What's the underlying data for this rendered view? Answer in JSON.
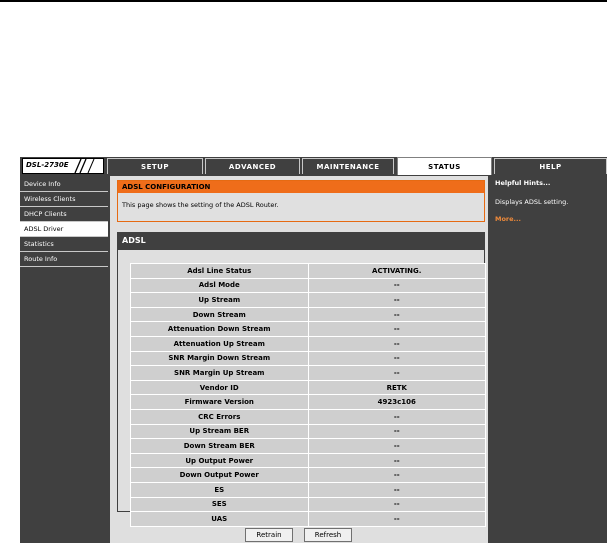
{
  "device": {
    "model": "DSL-2730E"
  },
  "tabs": [
    {
      "label": "SETUP",
      "active": false
    },
    {
      "label": "ADVANCED",
      "active": false
    },
    {
      "label": "MAINTENANCE",
      "active": false
    },
    {
      "label": "STATUS",
      "active": true
    },
    {
      "label": "HELP",
      "active": false
    }
  ],
  "sidebar": {
    "items": [
      {
        "label": "Device Info"
      },
      {
        "label": "Wireless Clients"
      },
      {
        "label": "DHCP Clients"
      },
      {
        "label": "ADSL Driver",
        "active": true
      },
      {
        "label": "Statistics"
      },
      {
        "label": "Route Info"
      }
    ]
  },
  "config": {
    "title": "ADSL CONFIGURATION",
    "description": "This page shows the setting of the ADSL Router."
  },
  "adsl": {
    "title": "ADSL",
    "rows": [
      {
        "label": "Adsl Line Status",
        "value": "ACTIVATING."
      },
      {
        "label": "Adsl Mode",
        "value": "--"
      },
      {
        "label": "Up Stream",
        "value": "--"
      },
      {
        "label": "Down Stream",
        "value": "--"
      },
      {
        "label": "Attenuation Down Stream",
        "value": "--"
      },
      {
        "label": "Attenuation Up Stream",
        "value": "--"
      },
      {
        "label": "SNR Margin Down Stream",
        "value": "--"
      },
      {
        "label": "SNR Margin Up Stream",
        "value": "--"
      },
      {
        "label": "Vendor ID",
        "value": "RETK"
      },
      {
        "label": "Firmware Version",
        "value": "4923c106"
      },
      {
        "label": "CRC Errors",
        "value": "--"
      },
      {
        "label": "Up Stream BER",
        "value": "--"
      },
      {
        "label": "Down Stream BER",
        "value": "--"
      },
      {
        "label": "Up Output Power",
        "value": "--"
      },
      {
        "label": "Down Output Power",
        "value": "--"
      },
      {
        "label": "ES",
        "value": "--"
      },
      {
        "label": "SES",
        "value": "--"
      },
      {
        "label": "UAS",
        "value": "--"
      }
    ]
  },
  "buttons": {
    "retrain": "Retrain",
    "refresh": "Refresh"
  },
  "help": {
    "title": "Helpful Hints...",
    "text": "Displays ADSL setting.",
    "more": "More..."
  },
  "colors": {
    "accent": "#ef6d1a",
    "panel": "#404040",
    "content": "#dfdfdf"
  }
}
